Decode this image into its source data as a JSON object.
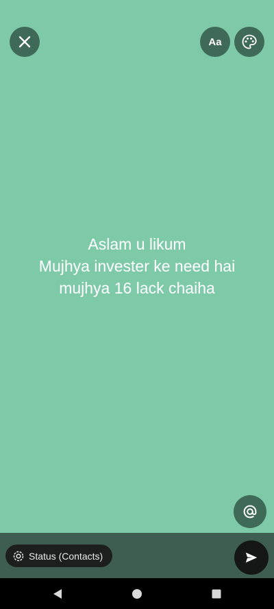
{
  "status": {
    "lines": [
      "Aslam u likum",
      "Mujhya invester ke need hai",
      "mujhya 16 lack chaiha"
    ]
  },
  "toolbar": {
    "font_label": "Aa",
    "close_icon": "close-icon",
    "palette_icon": "palette-icon"
  },
  "mention": {
    "icon": "at-icon"
  },
  "footer": {
    "privacy_label": "Status (Contacts)",
    "send_icon": "send-icon"
  },
  "colors": {
    "background": "#7ecaa8",
    "button": "#3f6a58",
    "bottom_bar": "#3e5e51"
  }
}
